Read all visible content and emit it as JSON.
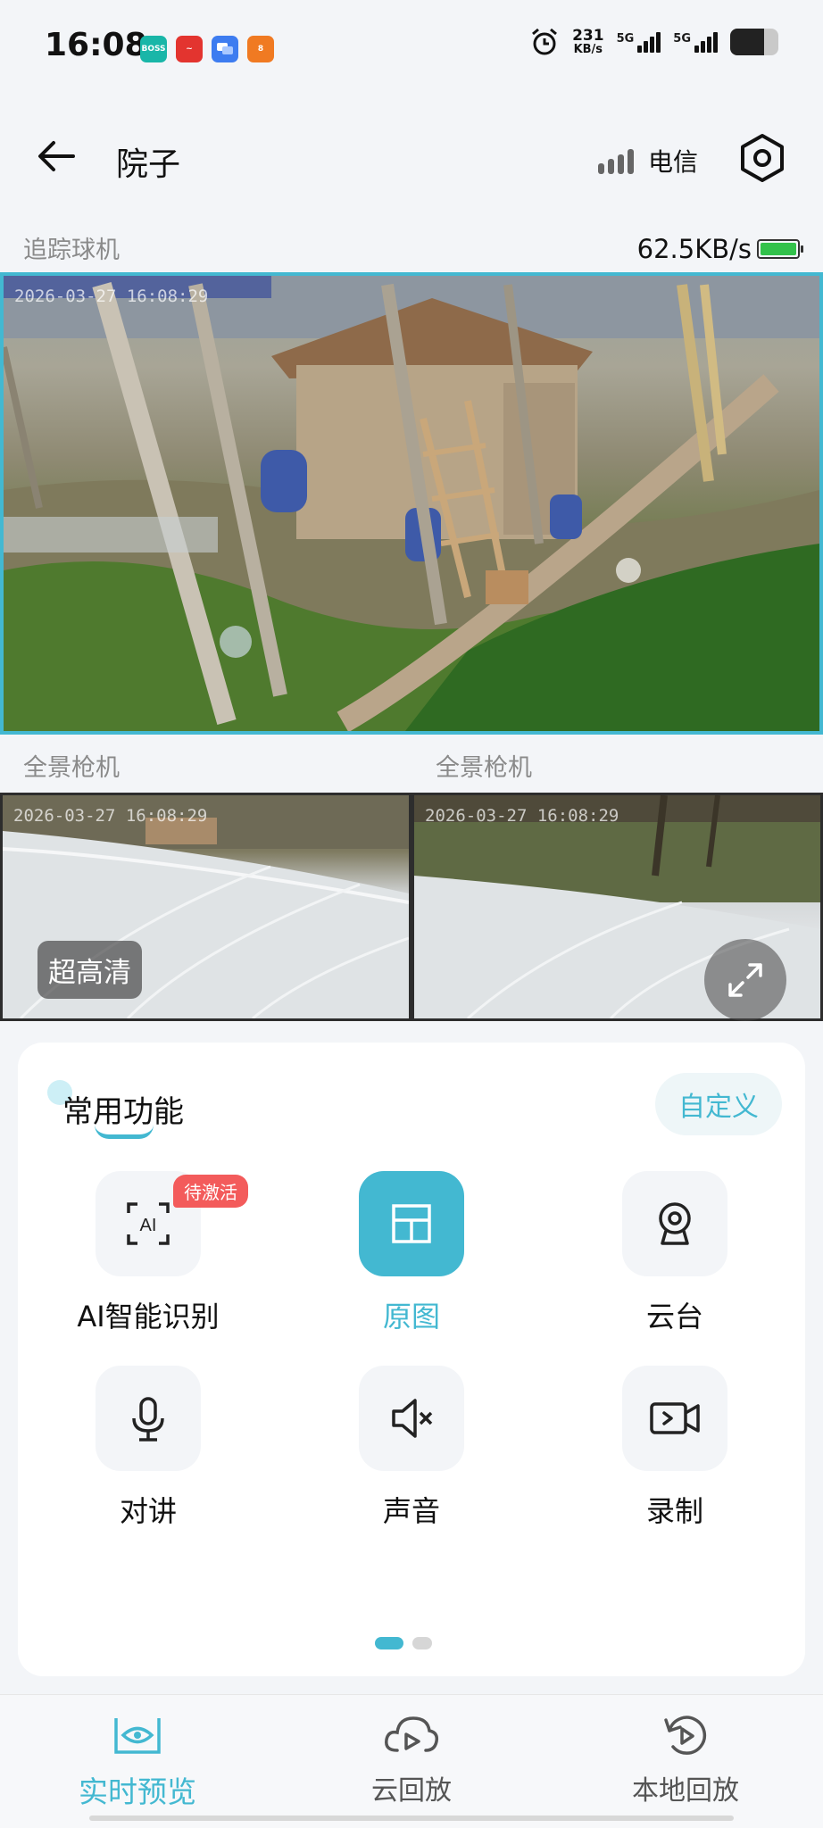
{
  "status_bar": {
    "time": "16:08",
    "apps": [
      {
        "name": "boss-app-icon",
        "color": "#19b6a8",
        "text": "BOSS"
      },
      {
        "name": "red-app-icon",
        "color": "#e3342f",
        "text": "~"
      },
      {
        "name": "chat-app-icon",
        "color": "#3d7cf0",
        "text": ""
      },
      {
        "name": "orange-app-icon",
        "color": "#f07a22",
        "text": "8"
      }
    ],
    "speed_num": "231",
    "speed_unit": "KB/s",
    "net1": "5G",
    "net2": "5G"
  },
  "header": {
    "title": "院子",
    "carrier": "电信"
  },
  "cameras": {
    "main_label": "追踪球机",
    "speed": "62.5KB/s",
    "main_timestamp": "2026-03-27 16:08:29",
    "sub_left_label": "全景枪机",
    "sub_right_label": "全景枪机",
    "sub_left_timestamp": "2026-03-27 16:08:29",
    "sub_right_timestamp": "2026-03-27 16:08:29",
    "hd_badge": "超高清"
  },
  "functions": {
    "title": "常用功能",
    "custom_button": "自定义",
    "pending_badge": "待激活",
    "items": [
      {
        "label": "AI智能识别",
        "icon": "ai-scan-icon",
        "active": false
      },
      {
        "label": "原图",
        "icon": "layout-icon",
        "active": true
      },
      {
        "label": "云台",
        "icon": "ptz-camera-icon",
        "active": false
      },
      {
        "label": "对讲",
        "icon": "microphone-icon",
        "active": false
      },
      {
        "label": "声音",
        "icon": "speaker-muted-icon",
        "active": false
      },
      {
        "label": "录制",
        "icon": "record-video-icon",
        "active": false
      }
    ],
    "page_count": 2,
    "current_page": 1
  },
  "bottom_nav": {
    "items": [
      {
        "label": "实时预览",
        "icon": "eye-icon",
        "active": true
      },
      {
        "label": "云回放",
        "icon": "cloud-playback-icon",
        "active": false
      },
      {
        "label": "本地回放",
        "icon": "local-playback-icon",
        "active": false
      }
    ]
  },
  "colors": {
    "accent": "#43b8d1",
    "badge": "#f35b5b",
    "battery_green": "#33c24b"
  }
}
